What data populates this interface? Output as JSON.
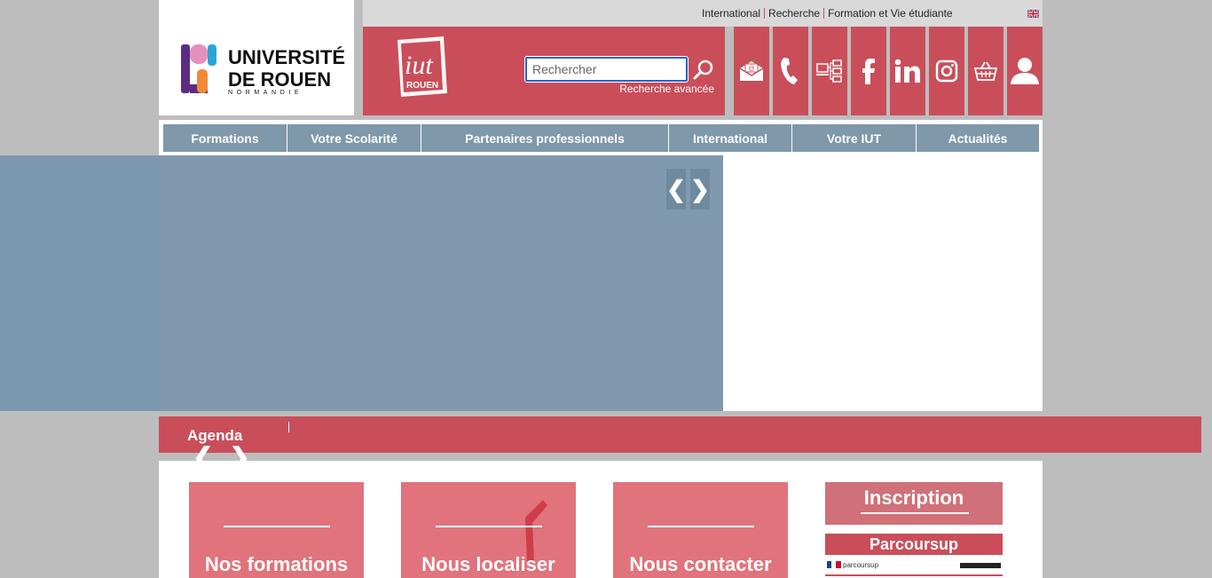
{
  "top_links": {
    "international": "International",
    "recherche": "Recherche",
    "formation": "Formation et Vie étudiante"
  },
  "language_flag": "uk-flag-icon",
  "logo": {
    "line1": "UNIVERSITÉ",
    "line2": "DE ROUEN",
    "line3": "NORMANDIE"
  },
  "iut_logo": {
    "line1": "iut",
    "line2": "ROUEN"
  },
  "search": {
    "placeholder": "Rechercher",
    "advanced": "Recherche avancée"
  },
  "icon_bar": [
    "mail-icon",
    "phone-icon",
    "ent-network-icon",
    "facebook-icon",
    "linkedin-icon",
    "instagram-icon",
    "basket-icon",
    "user-icon"
  ],
  "nav": [
    {
      "label": "Formations"
    },
    {
      "label": "Votre Scolarité"
    },
    {
      "label": "Partenaires professionnels"
    },
    {
      "label": "International"
    },
    {
      "label": "Votre IUT"
    },
    {
      "label": "Actualités"
    }
  ],
  "slider": {
    "prev": "❮",
    "next": "❯"
  },
  "agenda": {
    "title": "Agenda",
    "prev": "❮",
    "next": "❯"
  },
  "tiles": [
    {
      "label": "Nos formations"
    },
    {
      "label": "Nous localiser"
    },
    {
      "label": "Nous contacter"
    }
  ],
  "inscription": {
    "label": "Inscription"
  },
  "parcoursup": {
    "label": "Parcoursup",
    "sub": "parcoursup"
  },
  "colors": {
    "brand_red": "#c94e5a",
    "nav_blue": "#7f98aa",
    "slider_blue": "#7c98ae",
    "page_gray": "#bdbdbd"
  }
}
